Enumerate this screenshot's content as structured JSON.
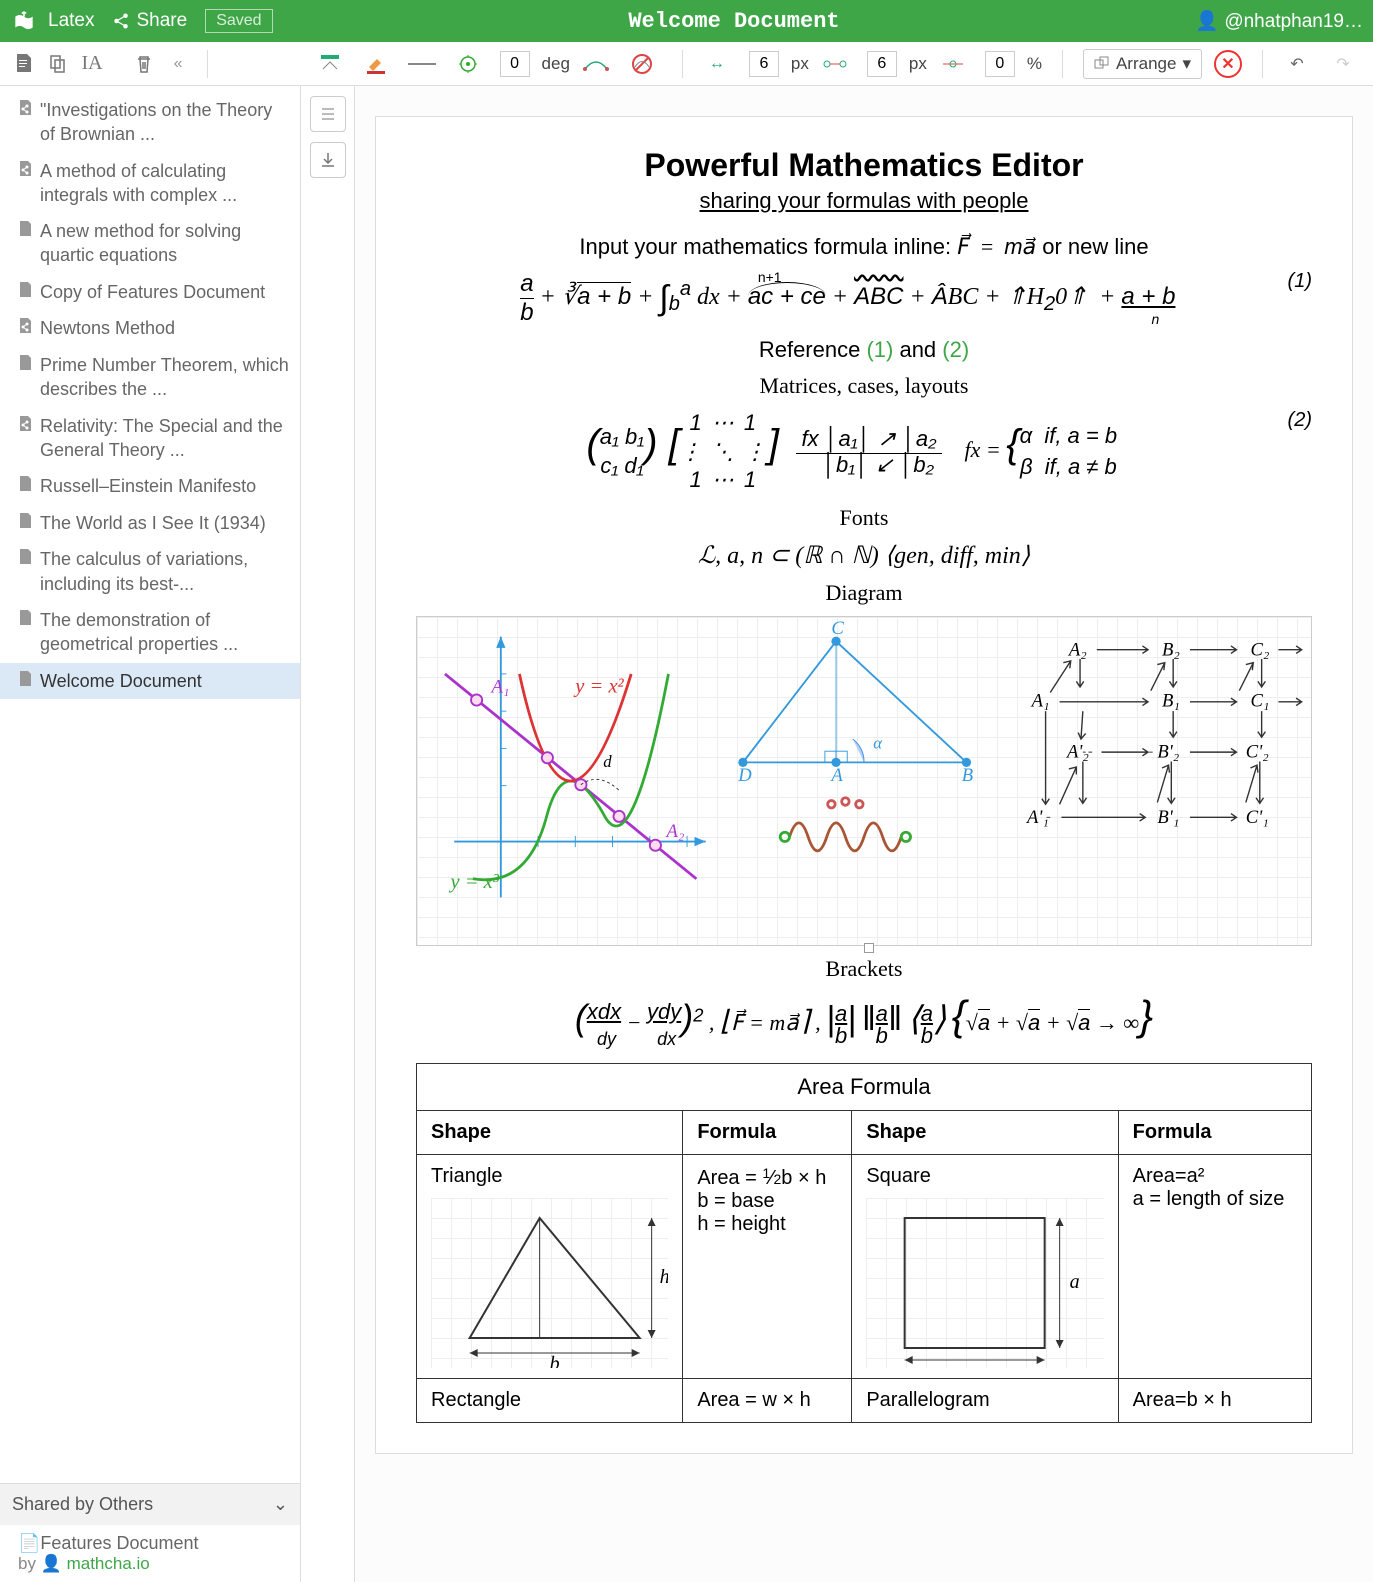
{
  "topbar": {
    "latex": "Latex",
    "share": "Share",
    "saved": "Saved",
    "title": "Welcome Document",
    "user": "@nhatphan19…"
  },
  "toolbar": {
    "rot": "0",
    "deg": "deg",
    "px1": "6",
    "px2": "6",
    "pct": "0",
    "pxlbl": "px",
    "pctlbl": "%",
    "arrange": "Arrange"
  },
  "files": [
    {
      "label": "\"Investigations on the Theory of Brownian ...",
      "icon": "share"
    },
    {
      "label": "A method of calculating integrals with complex ...",
      "icon": "share"
    },
    {
      "label": "A new method for solving quartic equations",
      "icon": "doc"
    },
    {
      "label": "Copy of Features Document",
      "icon": "doc"
    },
    {
      "label": "Newtons Method",
      "icon": "share"
    },
    {
      "label": "Prime Number Theorem, which describes the ...",
      "icon": "doc"
    },
    {
      "label": "Relativity: The Special and the General Theory ...",
      "icon": "share"
    },
    {
      "label": "Russell–Einstein Manifesto",
      "icon": "doc"
    },
    {
      "label": "The World as I See It (1934)",
      "icon": "doc"
    },
    {
      "label": "The calculus of variations, including its best-...",
      "icon": "doc"
    },
    {
      "label": "The demonstration of geometrical properties ...",
      "icon": "doc"
    },
    {
      "label": "Welcome Document",
      "icon": "doc",
      "selected": true
    }
  ],
  "shared": {
    "header": "Shared by Others",
    "item": "Features Document",
    "by": "by ",
    "author": "mathcha.io"
  },
  "doc": {
    "title": "Powerful Mathematics Editor",
    "subtitle": "sharing your formulas with people",
    "inlineIntro": "Input your mathematics formula inline: ",
    "inlineMid": " or new line",
    "eq1num": "(1)",
    "refText": "Reference ",
    "ref1": "(1)",
    "refAnd": " and ",
    "ref2": "(2)",
    "matricesHdr": "Matrices, cases, layouts",
    "eq2num": "(2)",
    "fontsHdr": "Fonts",
    "fontsLine": "ℒ, a, n ⊂ (ℝ ∩ ℕ) ⟨gen, diff, min⟩",
    "diagramHdr": "Diagram",
    "bracketsHdr": "Brackets",
    "areaHdr": "Area Formula",
    "table": {
      "h1": "Shape",
      "h2": "Formula",
      "h3": "Shape",
      "h4": "Formula",
      "r1c1": "Triangle",
      "r1c2a": "Area = ",
      "r1c2b": "b × h",
      "r1c2c": "b = base",
      "r1c2d": "h = height",
      "r1c3": "Square",
      "r1c4a": "Area=a²",
      "r1c4b": "a = length of size",
      "r2c1": "Rectangle",
      "r2c2": "Area = w × h",
      "r2c3": "Parallelogram",
      "r2c4": "Area=b × h"
    }
  }
}
